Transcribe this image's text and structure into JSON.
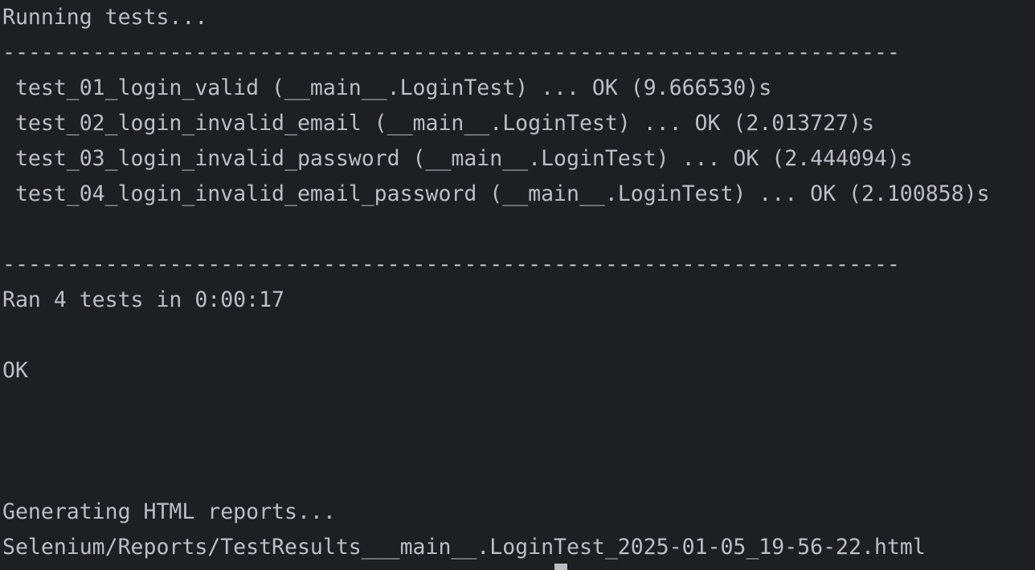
{
  "terminal": {
    "lines": [
      "Running tests...",
      "----------------------------------------------------------------------",
      " test_01_login_valid (__main__.LoginTest) ... OK (9.666530)s",
      " test_02_login_invalid_email (__main__.LoginTest) ... OK (2.013727)s",
      " test_03_login_invalid_password (__main__.LoginTest) ... OK (2.444094)s",
      " test_04_login_invalid_email_password (__main__.LoginTest) ... OK (2.100858)s",
      "",
      "----------------------------------------------------------------------",
      "Ran 4 tests in 0:00:17",
      "",
      "OK",
      "",
      "",
      "",
      "Generating HTML reports...",
      "Selenium/Reports/TestResults___main__.LoginTest_2025-01-05_19-56-22.html"
    ]
  },
  "colors": {
    "background": "#1e1f22",
    "text": "#bcbec4"
  }
}
